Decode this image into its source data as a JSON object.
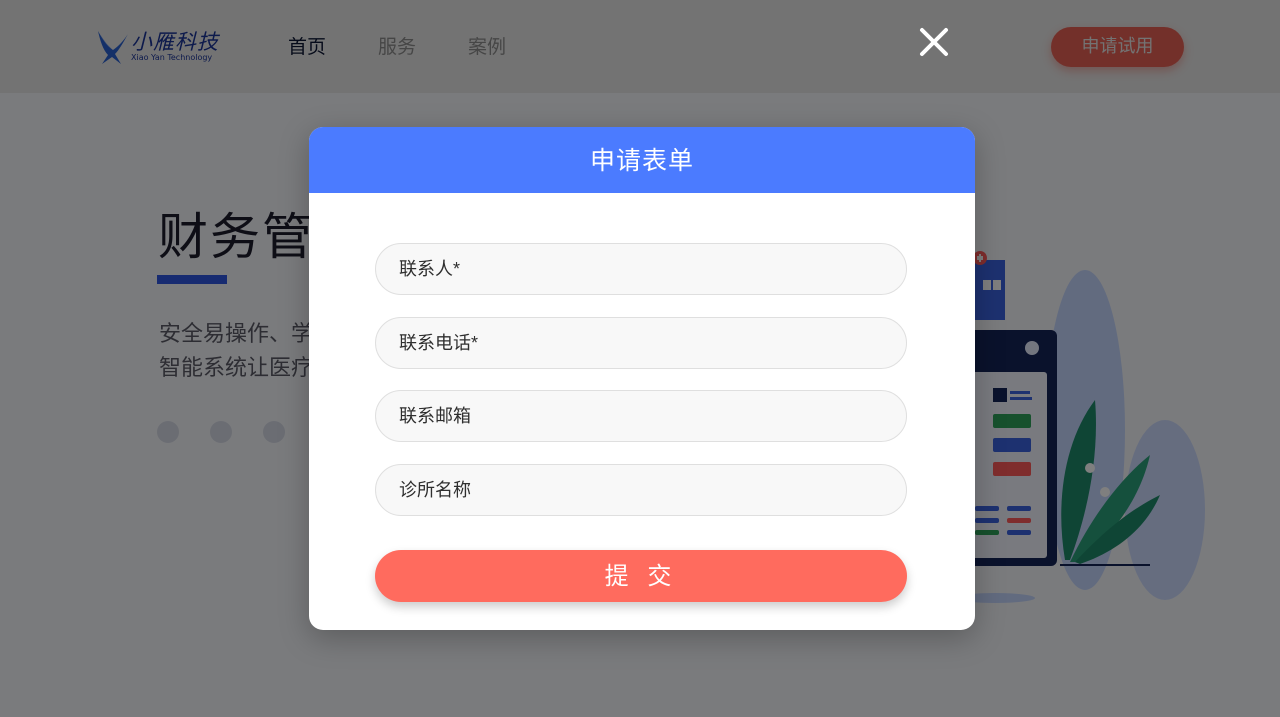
{
  "brand": {
    "name_cn": "小雁科技",
    "name_en": "Xiao Yan Technology",
    "logo_icon": "swallow-bird-icon"
  },
  "nav": {
    "items": [
      {
        "label": "首页",
        "active": true
      },
      {
        "label": "服务",
        "active": false
      },
      {
        "label": "案例",
        "active": false
      }
    ]
  },
  "header": {
    "trial_button": "申请试用"
  },
  "hero": {
    "title": "财务管",
    "desc_line1": "安全易操作、学",
    "desc_line2": "智能系统让医疗",
    "carousel_dots": 3
  },
  "modal": {
    "title": "申请表单",
    "close_icon": "close-icon",
    "fields": [
      {
        "placeholder": "联系人*",
        "value": ""
      },
      {
        "placeholder": "联系电话*",
        "value": ""
      },
      {
        "placeholder": "联系邮箱",
        "value": ""
      },
      {
        "placeholder": "诊所名称",
        "value": ""
      }
    ],
    "submit": "提 交"
  },
  "colors": {
    "primary": "#4b7bff",
    "accent": "#ff6b5e",
    "brand": "#1e3aa8",
    "overlay": "rgba(0,0,0,0.5)"
  }
}
